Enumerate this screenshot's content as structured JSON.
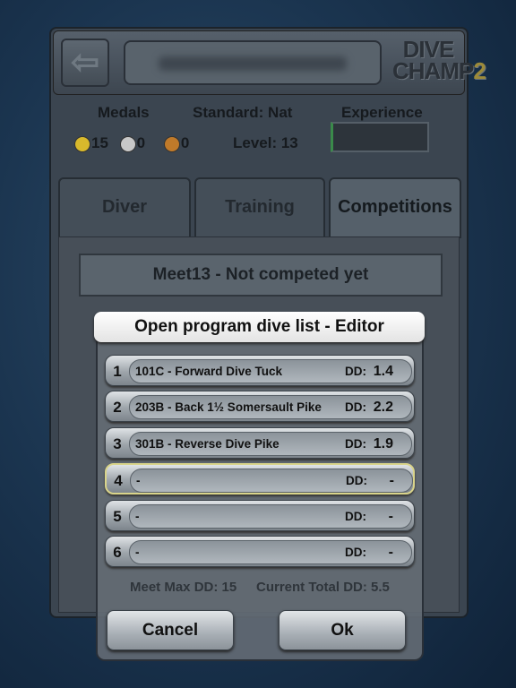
{
  "header": {
    "back_icon": "arrow-left-icon",
    "logo_top": "DIVE",
    "logo_bottom": "CHAMP",
    "logo_num": "2"
  },
  "stats": {
    "medals_label": "Medals",
    "gold": "15",
    "silver": "0",
    "bronze": "0",
    "standard": "Standard: Nat",
    "level": "Level: 13",
    "experience_label": "Experience",
    "experience_fraction": 0.01
  },
  "tabs": [
    {
      "label": "Diver"
    },
    {
      "label": "Training"
    },
    {
      "label": "Competitions",
      "active": true
    }
  ],
  "meet_status": "Meet13 - Not competed yet",
  "modal": {
    "title": "Open program dive list - Editor",
    "dd_label": "DD:",
    "rows": [
      {
        "num": "1",
        "dive": "101C - Forward Dive Tuck",
        "dd": "1.4"
      },
      {
        "num": "2",
        "dive": "203B - Back 1½ Somersault Pike",
        "dd": "2.2"
      },
      {
        "num": "3",
        "dive": "301B - Reverse Dive Pike",
        "dd": "1.9"
      },
      {
        "num": "4",
        "dive": "-",
        "dd": "-",
        "selected": true
      },
      {
        "num": "5",
        "dive": "-",
        "dd": "-"
      },
      {
        "num": "6",
        "dive": "-",
        "dd": "-"
      }
    ],
    "meet_max": "Meet Max DD: 15",
    "current_total": "Current Total DD: 5.5",
    "cancel": "Cancel",
    "ok": "Ok"
  },
  "colors": {
    "gold": "#d8b92c",
    "silver": "#c8c8c8",
    "bronze": "#c07a2a",
    "selected_border": "#d9d48a"
  }
}
